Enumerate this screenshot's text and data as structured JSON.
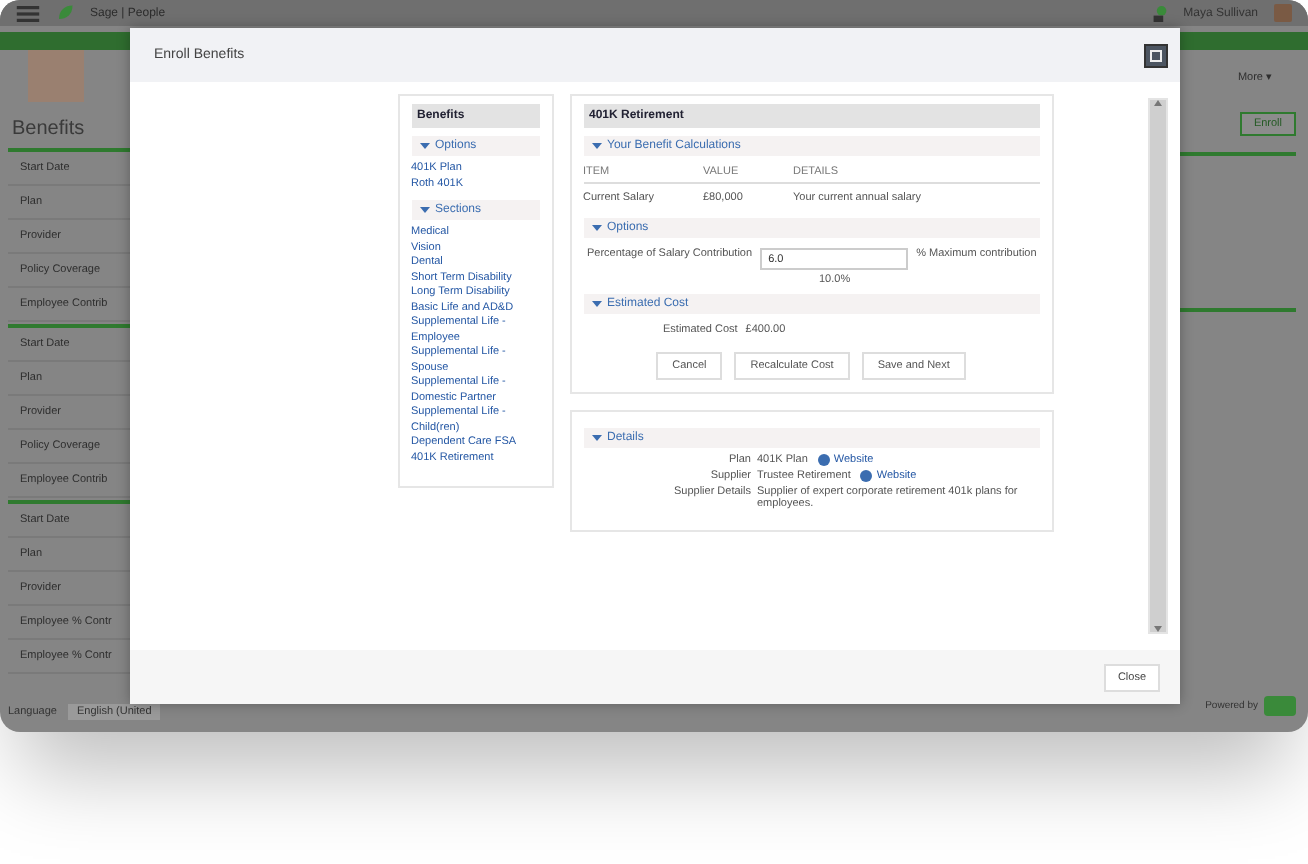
{
  "app_header": {
    "title": "Sage | People",
    "user_name": "Maya Sullivan"
  },
  "page": {
    "title": "Benefits",
    "more": "More ▾",
    "action": "Enroll",
    "groups": [
      [
        "Start Date",
        "Plan",
        "Provider",
        "Policy Coverage",
        "Employee Contrib"
      ],
      [
        "Start Date",
        "Plan",
        "Provider",
        "Policy Coverage",
        "Employee Contrib"
      ],
      [
        "Start Date",
        "Plan",
        "Provider",
        "Employee % Contr",
        "Employee % Contr"
      ]
    ]
  },
  "footer": {
    "language_label": "Language",
    "language_value": "English (United",
    "powered_by": "Powered by"
  },
  "dialog": {
    "title": "Enroll Benefits",
    "sidebar": {
      "title": "Benefits",
      "sections": [
        {
          "title": "Options",
          "expanded": true,
          "items": [
            "401K Plan",
            "Roth 401K"
          ]
        },
        {
          "title": "Sections",
          "expanded": true,
          "items": [
            "Medical",
            "Vision",
            "Dental",
            "Short Term Disability",
            "Long Term Disability",
            "Basic Life and AD&D",
            "Supplemental Life - Employee",
            "Supplemental Life - Spouse",
            "Supplemental Life - Domestic Partner",
            "Supplemental Life - Child(ren)",
            "Dependent Care FSA",
            "401K Retirement"
          ]
        }
      ]
    },
    "panel": {
      "title": "401K Retirement",
      "sections": [
        {
          "kind": "table",
          "title": "Your Benefit Calculations",
          "expanded": true,
          "columns": [
            "ITEM",
            "VALUE",
            "DETAILS"
          ],
          "rows": [
            [
              "Current Salary",
              "£80,000",
              "Your current annual salary"
            ]
          ]
        },
        {
          "kind": "form",
          "title": "Options",
          "expanded": true,
          "label": "Percentage of Salary Contribution",
          "value": "6.0",
          "hint": "% Maximum contribution",
          "hint_2": "10.0%"
        },
        {
          "kind": "cost",
          "title": "Estimated Cost",
          "expanded": true,
          "label": "Estimated Cost",
          "value": "£400.00"
        }
      ],
      "buttons": [
        "Cancel",
        "Recalculate Cost",
        "Save and Next"
      ]
    },
    "details": {
      "title": "Details",
      "expanded": true,
      "rows": [
        {
          "label": "Plan",
          "value": "401K Plan",
          "link": "Website"
        },
        {
          "label": "Supplier",
          "value": "Trustee Retirement",
          "link": "Website"
        },
        {
          "label": "Supplier Details",
          "value": "Supplier of expert corporate retirement 401k plans for employees."
        }
      ]
    },
    "close": "Close"
  }
}
